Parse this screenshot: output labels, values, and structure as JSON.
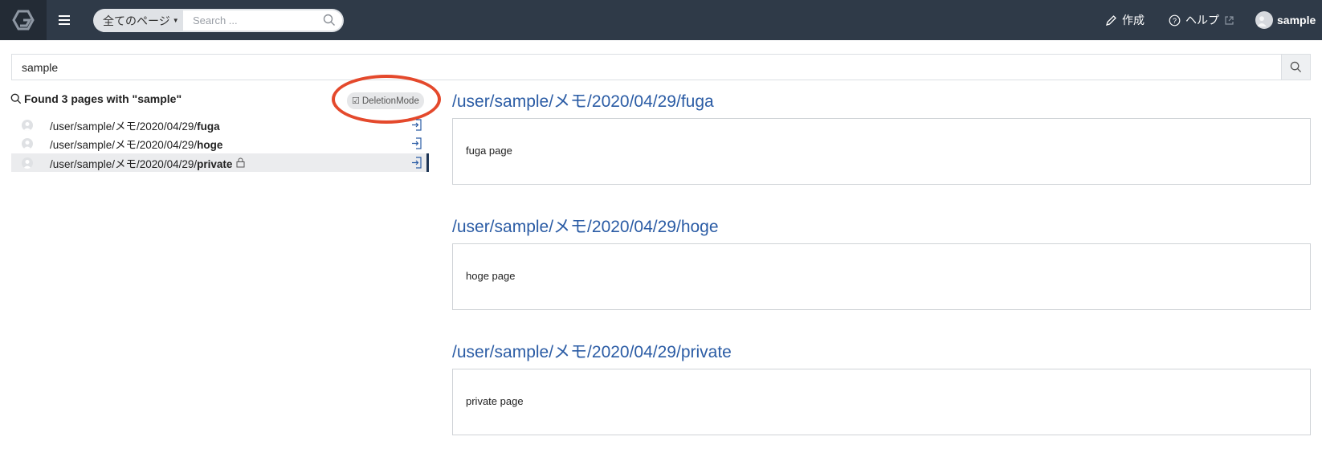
{
  "navbar": {
    "scope_label": "全てのページ",
    "search_placeholder": "Search ...",
    "create_label": "作成",
    "help_label": "ヘルプ",
    "user_label": "sample"
  },
  "search": {
    "query": "sample"
  },
  "results": {
    "found_text": "Found 3 pages with \"sample\"",
    "deletion_mode_label": "DeletionMode",
    "items": [
      {
        "prefix": "/user/sample/メモ/2020/04/29/",
        "name": "fuga"
      },
      {
        "prefix": "/user/sample/メモ/2020/04/29/",
        "name": "hoge"
      },
      {
        "prefix": "/user/sample/メモ/2020/04/29/",
        "name": "private"
      }
    ]
  },
  "previews": [
    {
      "title": "/user/sample/メモ/2020/04/29/fuga",
      "body": "fuga page"
    },
    {
      "title": "/user/sample/メモ/2020/04/29/hoge",
      "body": "hoge page"
    },
    {
      "title": "/user/sample/メモ/2020/04/29/private",
      "body": "private page"
    }
  ],
  "colors": {
    "navbar_bg": "#2f3a48",
    "link": "#2b5ca5",
    "highlight_annotation": "#e4492c"
  }
}
